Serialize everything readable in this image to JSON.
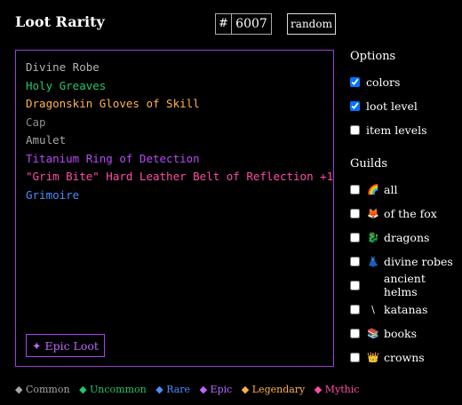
{
  "header": {
    "title": "Loot Rarity",
    "hash": "#",
    "id_value": "6007",
    "random_label": "random"
  },
  "items": [
    {
      "text": "Divine Robe",
      "color": "#b3b3b3"
    },
    {
      "text": "Holy Greaves",
      "color": "#22c76b"
    },
    {
      "text": "Dragonskin Gloves of Skill",
      "color": "#ffb347"
    },
    {
      "text": "Cap",
      "color": "#8c8c8c"
    },
    {
      "text": "Amulet",
      "color": "#a6a6a6"
    },
    {
      "text": "Titanium Ring of Detection",
      "color": "#b64cf5"
    },
    {
      "text": "\"Grim Bite\" Hard Leather Belt of Reflection +1",
      "color": "#ff4da6"
    },
    {
      "text": "Grimoire",
      "color": "#4c8dff"
    }
  ],
  "panel": {
    "badge_label": "✦ Epic Loot",
    "badge_color": "#c066ff"
  },
  "options": {
    "heading": "Options",
    "items": [
      {
        "label": "colors",
        "checked": true
      },
      {
        "label": "loot level",
        "checked": true
      },
      {
        "label": "item levels",
        "checked": false
      }
    ]
  },
  "guilds": {
    "heading": "Guilds",
    "items": [
      {
        "emoji": "🌈",
        "label": "all"
      },
      {
        "emoji": "🦊",
        "label": "of the fox"
      },
      {
        "emoji": "🐉",
        "label": "dragons"
      },
      {
        "emoji": "👗",
        "label": "divine robes"
      },
      {
        "emoji": "",
        "label": "ancient helms"
      },
      {
        "emoji": "\\",
        "label": "katanas"
      },
      {
        "emoji": "📚",
        "label": "books"
      },
      {
        "emoji": "👑",
        "label": "crowns"
      }
    ]
  },
  "legend": [
    {
      "label": "◆ Common",
      "color": "#a6a6a6"
    },
    {
      "label": "◆ Uncommon",
      "color": "#22c76b"
    },
    {
      "label": "◆ Rare",
      "color": "#4c8dff"
    },
    {
      "label": "◆ Epic",
      "color": "#c066ff"
    },
    {
      "label": "◆ Legendary",
      "color": "#ffb347"
    },
    {
      "label": "◆ Mythic",
      "color": "#ff4da6"
    }
  ]
}
